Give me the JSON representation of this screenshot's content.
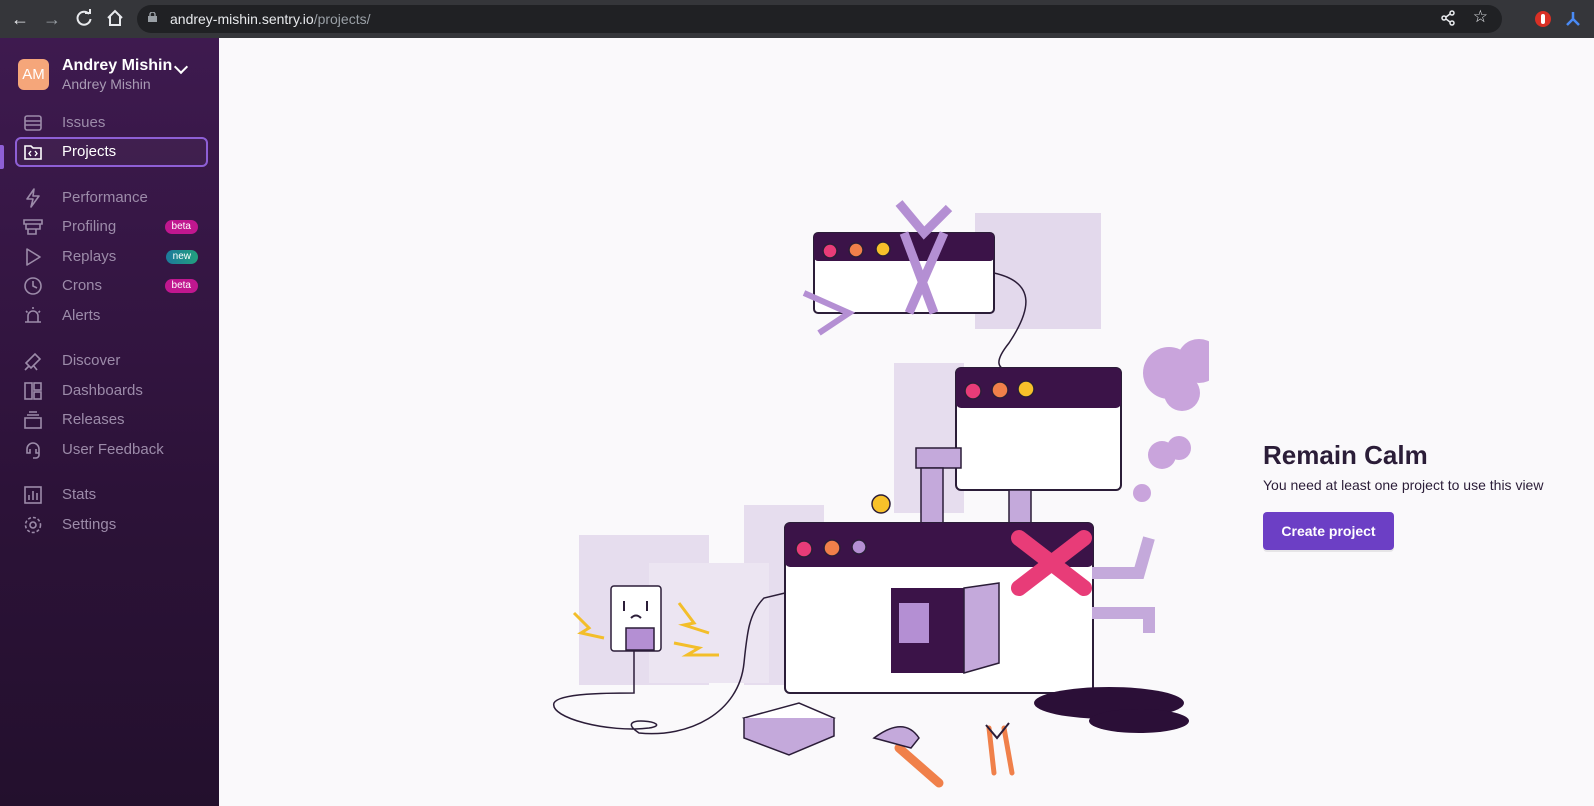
{
  "browser": {
    "url_host": "andrey-mishin.sentry.io",
    "url_path": "/projects/"
  },
  "org": {
    "initials": "AM",
    "name": "Andrey Mishin",
    "user": "Andrey Mishin"
  },
  "sidebar": {
    "items": [
      {
        "label": "Issues",
        "icon": "issues-icon"
      },
      {
        "label": "Projects",
        "icon": "projects-icon",
        "active": true
      },
      {
        "label": "Performance",
        "icon": "performance-icon"
      },
      {
        "label": "Profiling",
        "icon": "profiling-icon",
        "badge": "beta"
      },
      {
        "label": "Replays",
        "icon": "replays-icon",
        "badge": "new"
      },
      {
        "label": "Crons",
        "icon": "crons-icon",
        "badge": "beta"
      },
      {
        "label": "Alerts",
        "icon": "alerts-icon"
      },
      {
        "label": "Discover",
        "icon": "discover-icon"
      },
      {
        "label": "Dashboards",
        "icon": "dashboards-icon"
      },
      {
        "label": "Releases",
        "icon": "releases-icon"
      },
      {
        "label": "User Feedback",
        "icon": "user-feedback-icon"
      },
      {
        "label": "Stats",
        "icon": "stats-icon"
      },
      {
        "label": "Settings",
        "icon": "settings-icon"
      }
    ]
  },
  "empty_state": {
    "title": "Remain Calm",
    "description": "You need at least one project to use this view",
    "button": "Create project"
  },
  "colors": {
    "accent": "#6c3fc5",
    "sidebar_bg": "#3e1a4f",
    "badge_beta": "#c0178f"
  }
}
